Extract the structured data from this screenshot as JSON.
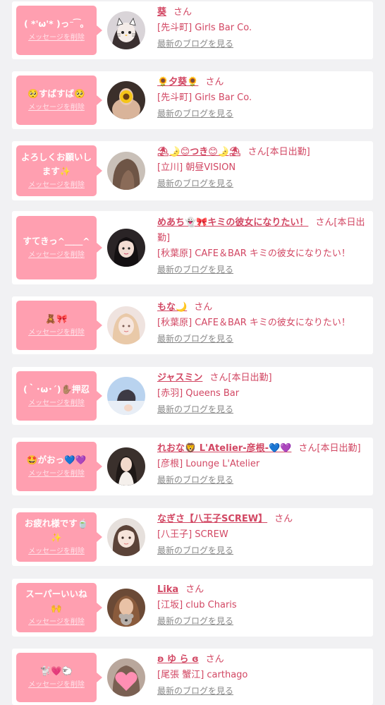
{
  "messages": [
    {
      "text": "( *'ω'* )っ⁻ ͡ 。",
      "delete_label": "メッセージを削除",
      "name": "葵",
      "san": "さん",
      "status": "",
      "shop": "[先斗町] Girls Bar Co.",
      "blog": "最新のブログを見る",
      "avatar_icon": "cat-avatar"
    },
    {
      "text": "🥺すばすば🥺",
      "delete_label": "メッセージを削除",
      "name": "🌻夕葵🌻",
      "san": "さん",
      "status": "",
      "shop": "[先斗町] Girls Bar Co.",
      "blog": "最新のブログを見る",
      "avatar_icon": "sunflower-avatar"
    },
    {
      "text": "よろしくお願いします✨",
      "delete_label": "メッセージを削除",
      "name": "⛱🌛😊つき😊🌛⛱",
      "san": "さん",
      "status": "[本日出勤]",
      "shop": "[立川] 朝昼VISION",
      "blog": "最新のブログを見る",
      "avatar_icon": "hair-avatar"
    },
    {
      "text": "すてきっ^＿＿^",
      "delete_label": "メッセージを削除",
      "name": "めあち👻🎀キミの彼女になりたい！",
      "san": "さん",
      "status": "[本日出勤]",
      "shop": "[秋葉原] CAFE＆BAR キミの彼女になりたい！",
      "blog": "最新のブログを見る",
      "avatar_icon": "girl-avatar"
    },
    {
      "text": "🧸🎀",
      "delete_label": "メッセージを削除",
      "name": "もな🌙",
      "san": "さん",
      "status": "",
      "shop": "[秋葉原] CAFE＆BAR キミの彼女になりたい！",
      "blog": "最新のブログを見る",
      "avatar_icon": "blonde-avatar"
    },
    {
      "text": "(｀･ω･´)✋🏽押忍",
      "delete_label": "メッセージを削除",
      "name": "ジャスミン",
      "san": "さん",
      "status": "[本日出勤]",
      "shop": "[赤羽] Queens Bar",
      "blog": "最新のブログを見る",
      "avatar_icon": "sky-avatar"
    },
    {
      "text": "🤩がおっ💙💜",
      "delete_label": "メッセージを削除",
      "name": "れおな🦁 L'Atelier-彦根-💙💜",
      "san": "さん",
      "status": "[本日出勤]",
      "shop": "[彦根] Lounge L'Atelier",
      "blog": "最新のブログを見る",
      "avatar_icon": "dress-avatar"
    },
    {
      "text": "お疲れ様です🍵✨",
      "delete_label": "メッセージを削除",
      "name": "なぎさ【八王子SCREW】",
      "san": "さん",
      "status": "",
      "shop": "[八王子] SCREW",
      "blog": "最新のブログを見る",
      "avatar_icon": "face-avatar"
    },
    {
      "text": "スーパーいいね🙌",
      "delete_label": "メッセージを削除",
      "name": "Lika",
      "san": "さん",
      "status": "",
      "shop": "[江坂] club Charis",
      "blog": "最新のブログを見る",
      "avatar_icon": "koala-avatar"
    },
    {
      "text": "🐩💗🐑",
      "delete_label": "メッセージを削除",
      "name": "ʚ ゆ ら ɞ",
      "san": "さん",
      "status": "",
      "shop": "[尾張 蟹江] carthago",
      "blog": "最新のブログを見る",
      "avatar_icon": "heart-avatar"
    }
  ]
}
